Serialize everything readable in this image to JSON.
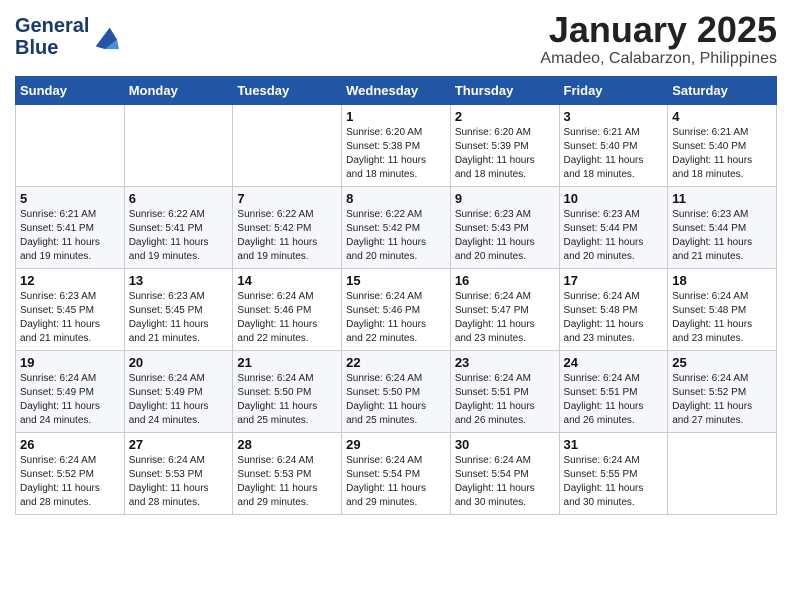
{
  "logo": {
    "line1": "General",
    "line2": "Blue"
  },
  "title": "January 2025",
  "subtitle": "Amadeo, Calabarzon, Philippines",
  "weekdays": [
    "Sunday",
    "Monday",
    "Tuesday",
    "Wednesday",
    "Thursday",
    "Friday",
    "Saturday"
  ],
  "weeks": [
    [
      {
        "day": "",
        "info": ""
      },
      {
        "day": "",
        "info": ""
      },
      {
        "day": "",
        "info": ""
      },
      {
        "day": "1",
        "info": "Sunrise: 6:20 AM\nSunset: 5:38 PM\nDaylight: 11 hours\nand 18 minutes."
      },
      {
        "day": "2",
        "info": "Sunrise: 6:20 AM\nSunset: 5:39 PM\nDaylight: 11 hours\nand 18 minutes."
      },
      {
        "day": "3",
        "info": "Sunrise: 6:21 AM\nSunset: 5:40 PM\nDaylight: 11 hours\nand 18 minutes."
      },
      {
        "day": "4",
        "info": "Sunrise: 6:21 AM\nSunset: 5:40 PM\nDaylight: 11 hours\nand 18 minutes."
      }
    ],
    [
      {
        "day": "5",
        "info": "Sunrise: 6:21 AM\nSunset: 5:41 PM\nDaylight: 11 hours\nand 19 minutes."
      },
      {
        "day": "6",
        "info": "Sunrise: 6:22 AM\nSunset: 5:41 PM\nDaylight: 11 hours\nand 19 minutes."
      },
      {
        "day": "7",
        "info": "Sunrise: 6:22 AM\nSunset: 5:42 PM\nDaylight: 11 hours\nand 19 minutes."
      },
      {
        "day": "8",
        "info": "Sunrise: 6:22 AM\nSunset: 5:42 PM\nDaylight: 11 hours\nand 20 minutes."
      },
      {
        "day": "9",
        "info": "Sunrise: 6:23 AM\nSunset: 5:43 PM\nDaylight: 11 hours\nand 20 minutes."
      },
      {
        "day": "10",
        "info": "Sunrise: 6:23 AM\nSunset: 5:44 PM\nDaylight: 11 hours\nand 20 minutes."
      },
      {
        "day": "11",
        "info": "Sunrise: 6:23 AM\nSunset: 5:44 PM\nDaylight: 11 hours\nand 21 minutes."
      }
    ],
    [
      {
        "day": "12",
        "info": "Sunrise: 6:23 AM\nSunset: 5:45 PM\nDaylight: 11 hours\nand 21 minutes."
      },
      {
        "day": "13",
        "info": "Sunrise: 6:23 AM\nSunset: 5:45 PM\nDaylight: 11 hours\nand 21 minutes."
      },
      {
        "day": "14",
        "info": "Sunrise: 6:24 AM\nSunset: 5:46 PM\nDaylight: 11 hours\nand 22 minutes."
      },
      {
        "day": "15",
        "info": "Sunrise: 6:24 AM\nSunset: 5:46 PM\nDaylight: 11 hours\nand 22 minutes."
      },
      {
        "day": "16",
        "info": "Sunrise: 6:24 AM\nSunset: 5:47 PM\nDaylight: 11 hours\nand 23 minutes."
      },
      {
        "day": "17",
        "info": "Sunrise: 6:24 AM\nSunset: 5:48 PM\nDaylight: 11 hours\nand 23 minutes."
      },
      {
        "day": "18",
        "info": "Sunrise: 6:24 AM\nSunset: 5:48 PM\nDaylight: 11 hours\nand 23 minutes."
      }
    ],
    [
      {
        "day": "19",
        "info": "Sunrise: 6:24 AM\nSunset: 5:49 PM\nDaylight: 11 hours\nand 24 minutes."
      },
      {
        "day": "20",
        "info": "Sunrise: 6:24 AM\nSunset: 5:49 PM\nDaylight: 11 hours\nand 24 minutes."
      },
      {
        "day": "21",
        "info": "Sunrise: 6:24 AM\nSunset: 5:50 PM\nDaylight: 11 hours\nand 25 minutes."
      },
      {
        "day": "22",
        "info": "Sunrise: 6:24 AM\nSunset: 5:50 PM\nDaylight: 11 hours\nand 25 minutes."
      },
      {
        "day": "23",
        "info": "Sunrise: 6:24 AM\nSunset: 5:51 PM\nDaylight: 11 hours\nand 26 minutes."
      },
      {
        "day": "24",
        "info": "Sunrise: 6:24 AM\nSunset: 5:51 PM\nDaylight: 11 hours\nand 26 minutes."
      },
      {
        "day": "25",
        "info": "Sunrise: 6:24 AM\nSunset: 5:52 PM\nDaylight: 11 hours\nand 27 minutes."
      }
    ],
    [
      {
        "day": "26",
        "info": "Sunrise: 6:24 AM\nSunset: 5:52 PM\nDaylight: 11 hours\nand 28 minutes."
      },
      {
        "day": "27",
        "info": "Sunrise: 6:24 AM\nSunset: 5:53 PM\nDaylight: 11 hours\nand 28 minutes."
      },
      {
        "day": "28",
        "info": "Sunrise: 6:24 AM\nSunset: 5:53 PM\nDaylight: 11 hours\nand 29 minutes."
      },
      {
        "day": "29",
        "info": "Sunrise: 6:24 AM\nSunset: 5:54 PM\nDaylight: 11 hours\nand 29 minutes."
      },
      {
        "day": "30",
        "info": "Sunrise: 6:24 AM\nSunset: 5:54 PM\nDaylight: 11 hours\nand 30 minutes."
      },
      {
        "day": "31",
        "info": "Sunrise: 6:24 AM\nSunset: 5:55 PM\nDaylight: 11 hours\nand 30 minutes."
      },
      {
        "day": "",
        "info": ""
      }
    ]
  ]
}
